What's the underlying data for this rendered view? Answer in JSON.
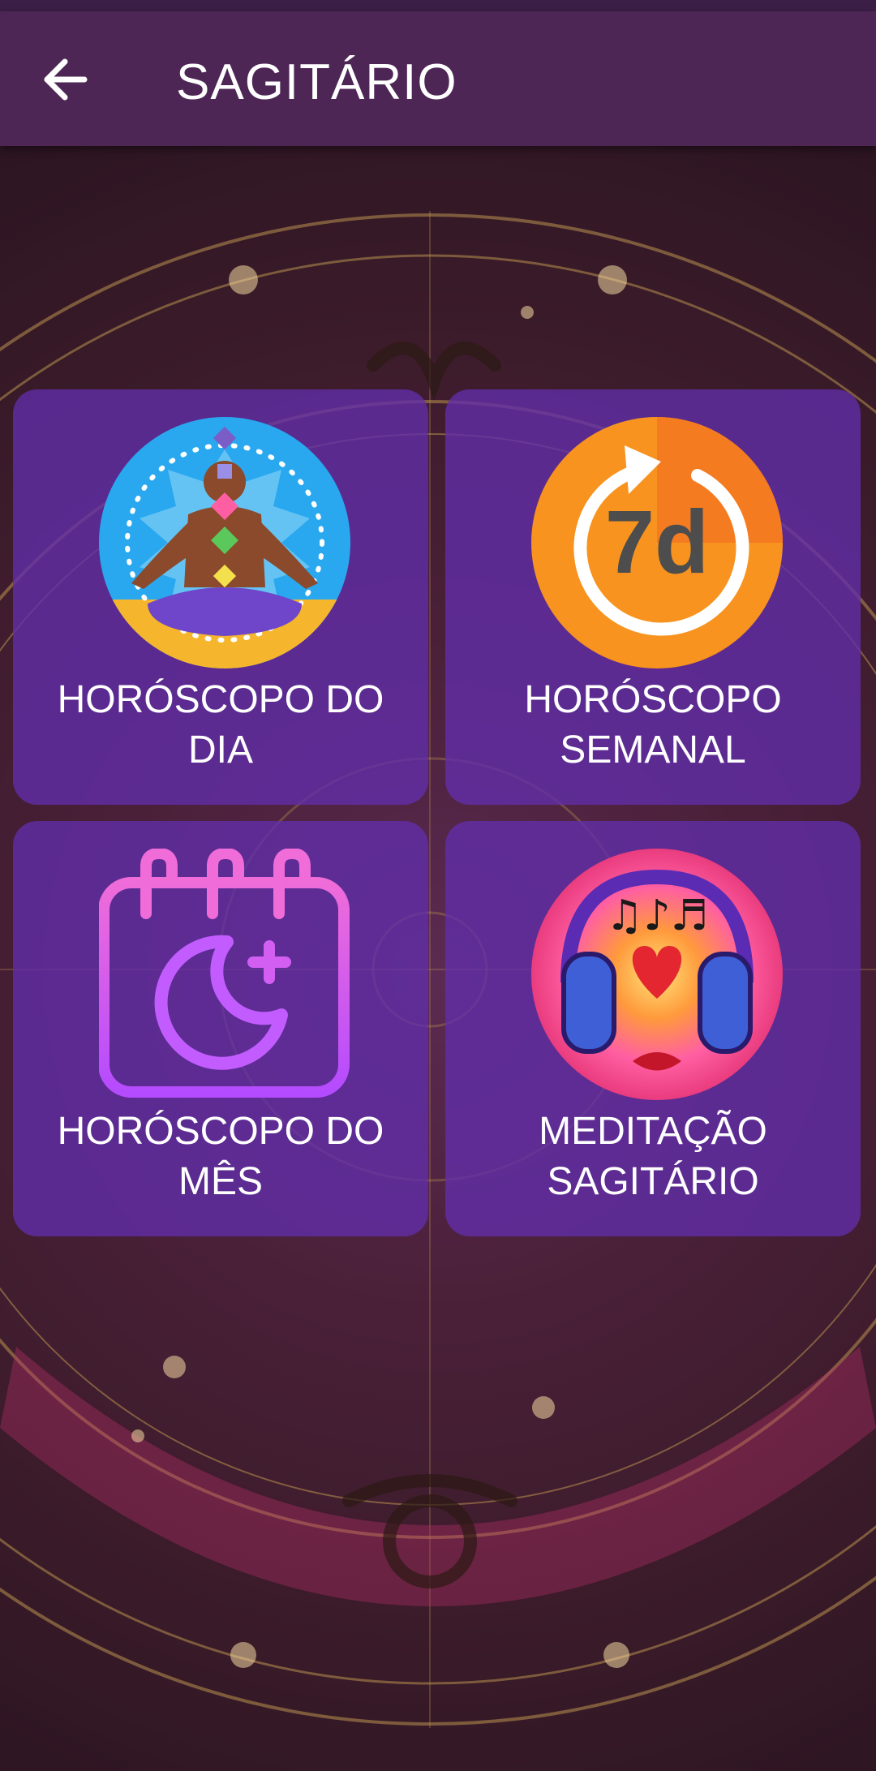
{
  "app_bar": {
    "title": "SAGITÁRIO",
    "back_icon": "arrow-left-icon"
  },
  "tiles": [
    {
      "line1": "HORÓSCOPO DO",
      "line2": "DIA",
      "icon": "meditation-chakra-icon"
    },
    {
      "line1": "HORÓSCOPO",
      "line2": "SEMANAL",
      "icon": "seven-day-icon",
      "icon_text": "7d"
    },
    {
      "line1": "HORÓSCOPO DO",
      "line2": "MÊS",
      "icon": "calendar-moon-icon"
    },
    {
      "line1": "MEDITAÇÃO",
      "line2": "SAGITÁRIO",
      "icon": "headphones-music-icon"
    }
  ],
  "colors": {
    "app_bar": "#4e2656",
    "tile": "#622eaa",
    "accent_orange": "#f7931e",
    "calendar_purple": "#c94dff"
  }
}
